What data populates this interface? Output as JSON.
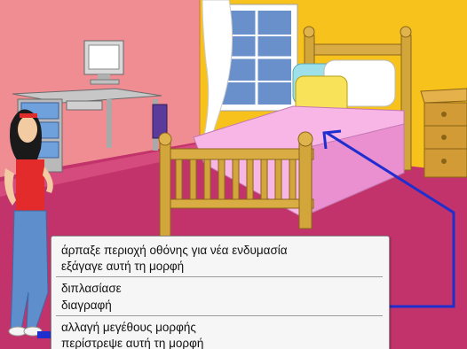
{
  "scene": {
    "description_icons": [
      "computer-monitor-icon",
      "desk-icon",
      "bed-icon",
      "window-icon",
      "nightstand-icon",
      "character-sprite",
      "arrow-pointer"
    ]
  },
  "context_menu": {
    "items": [
      {
        "label": "άρπαξε περιοχή οθόνης για νέα ενδυμασία"
      },
      {
        "label": "εξάγαγε αυτή τη μορφή"
      },
      {
        "label": "διπλασίασε"
      },
      {
        "label": "διαγραφή"
      },
      {
        "label": "αλλαγή μεγέθους μορφής"
      },
      {
        "label": "περίστρεψε αυτή τη μορφή"
      }
    ]
  },
  "colors": {
    "left_wall": "#ef8d93",
    "back_wall": "#f7c21c",
    "floor": "#c2336b",
    "arrow": "#1f2ecf",
    "menu_bg": "#f6f6f6"
  }
}
